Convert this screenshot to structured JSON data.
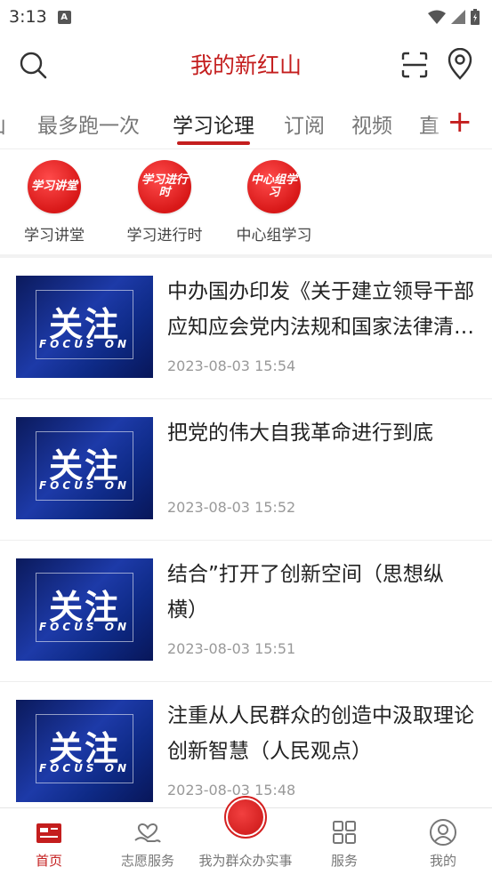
{
  "status_bar": {
    "time": "3:13",
    "notification_badge": "A"
  },
  "header": {
    "title": "我的新红山"
  },
  "tabs": [
    {
      "label": "山"
    },
    {
      "label": "最多跑一次"
    },
    {
      "label": "学习论理",
      "active": true
    },
    {
      "label": "订阅"
    },
    {
      "label": "视频"
    },
    {
      "label": "直"
    }
  ],
  "tab_add_label": "+",
  "shortcuts": [
    {
      "icon_text": "学习讲堂",
      "label": "学习讲堂"
    },
    {
      "icon_text": "学习进行时",
      "label": "学习进行时"
    },
    {
      "icon_text": "中心组学习",
      "label": "中心组学习"
    }
  ],
  "news": [
    {
      "thumb_main": "关注",
      "thumb_sub": "FOCUS ON",
      "title": "中办国办印发《关于建立领导干部应知应会党内法规和国家法律清单制度的意见》",
      "time": "2023-08-03 15:54"
    },
    {
      "thumb_main": "关注",
      "thumb_sub": "FOCUS ON",
      "title": "把党的伟大自我革命进行到底",
      "time": "2023-08-03 15:52"
    },
    {
      "thumb_main": "关注",
      "thumb_sub": "FOCUS ON",
      "title": "结合”打开了创新空间（思想纵横）",
      "time": "2023-08-03 15:51"
    },
    {
      "thumb_main": "关注",
      "thumb_sub": "FOCUS ON",
      "title": "注重从人民群众的创造中汲取理论创新智慧（人民观点）",
      "time": "2023-08-03 15:48"
    }
  ],
  "bottom_nav": [
    {
      "label": "首页",
      "icon": "home-news-icon",
      "active": true
    },
    {
      "label": "志愿服务",
      "icon": "volunteer-icon"
    },
    {
      "label": "我为群众办实事",
      "icon": "center-logo-icon"
    },
    {
      "label": "服务",
      "icon": "grid-icon"
    },
    {
      "label": "我的",
      "icon": "user-icon"
    }
  ],
  "colors": {
    "accent": "#c41e1e",
    "text": "#222222",
    "muted": "#999999"
  }
}
